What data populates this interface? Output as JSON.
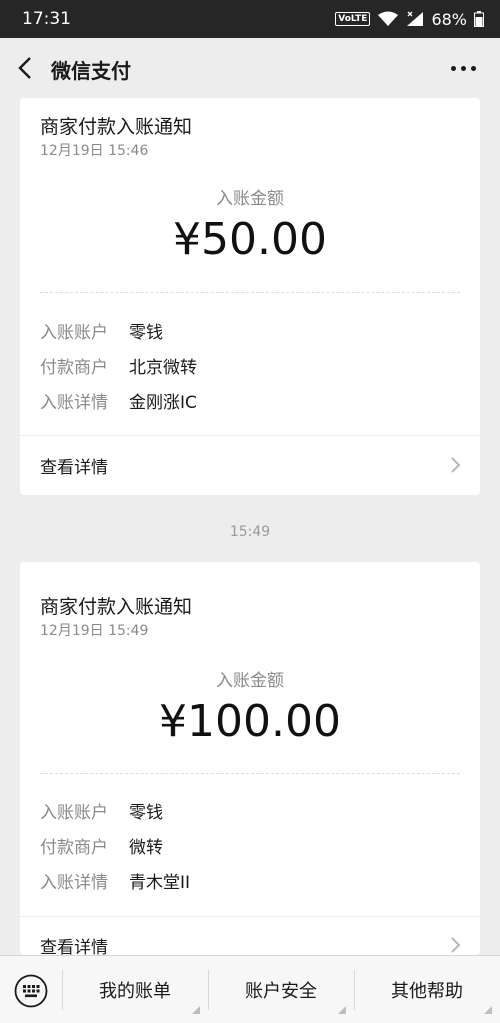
{
  "status_bar": {
    "time": "17:31",
    "network_badge": "VoLTE",
    "battery_percent": "68%",
    "icons": [
      "volte-icon",
      "wifi-icon",
      "signal-icon",
      "battery-icon"
    ]
  },
  "nav": {
    "title": "微信支付",
    "back_icon": "chevron-left-icon",
    "more_icon": "more-dots-icon"
  },
  "separator_time": "15:49",
  "messages": [
    {
      "title": "商家付款入账通知",
      "date": "12月19日 15:46",
      "amount_label": "入账金额",
      "amount": "¥50.00",
      "rows": [
        {
          "label": "入账账户",
          "value": "零钱"
        },
        {
          "label": "付款商户",
          "value": "北京微转"
        },
        {
          "label": "入账详情",
          "value": "金刚涨IC"
        }
      ],
      "detail_label": "查看详情"
    },
    {
      "title": "商家付款入账通知",
      "date": "12月19日 15:49",
      "amount_label": "入账金额",
      "amount": "¥100.00",
      "rows": [
        {
          "label": "入账账户",
          "value": "零钱"
        },
        {
          "label": "付款商户",
          "value": "微转"
        },
        {
          "label": "入账详情",
          "value": "青木堂II"
        }
      ],
      "detail_label": "查看详情"
    }
  ],
  "bottom_menu": {
    "keyboard_icon": "keyboard-icon",
    "items": [
      "我的账单",
      "账户安全",
      "其他帮助"
    ]
  },
  "colors": {
    "background": "#ededed",
    "card": "#ffffff",
    "status_bar": "#262626",
    "muted_text": "#8a8a8a"
  }
}
